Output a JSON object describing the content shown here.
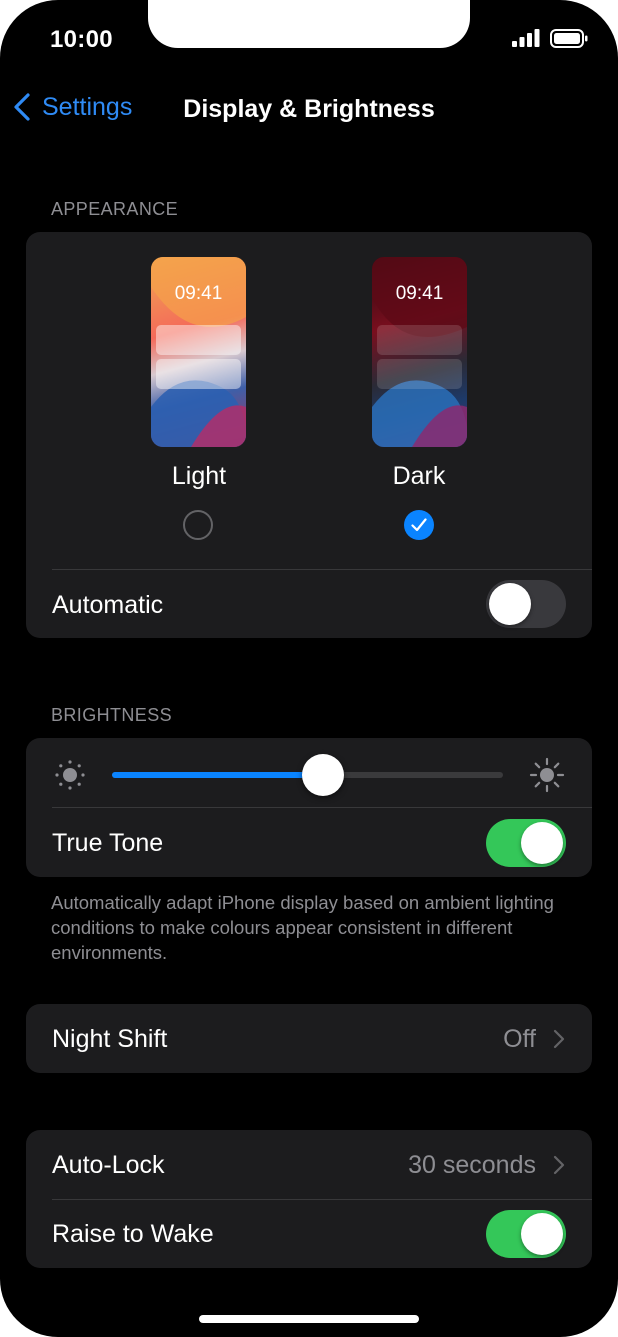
{
  "status_bar": {
    "time": "10:00"
  },
  "nav": {
    "back_label": "Settings",
    "title": "Display & Brightness"
  },
  "appearance": {
    "header": "APPEARANCE",
    "light": {
      "time": "09:41",
      "label": "Light",
      "selected": false
    },
    "dark": {
      "time": "09:41",
      "label": "Dark",
      "selected": true
    },
    "automatic": {
      "label": "Automatic",
      "on": false
    }
  },
  "brightness": {
    "header": "BRIGHTNESS",
    "level": 0.54,
    "true_tone": {
      "label": "True Tone",
      "on": true
    },
    "footnote": "Automatically adapt iPhone display based on ambient lighting conditions to make colours appear consistent in different environments."
  },
  "night_shift": {
    "label": "Night Shift",
    "value": "Off"
  },
  "auto_lock": {
    "label": "Auto-Lock",
    "value": "30 seconds"
  },
  "raise_to_wake": {
    "label": "Raise to Wake",
    "on": true
  },
  "colors": {
    "accent": "#0a84ff",
    "toggle_on": "#34c759",
    "background": "#000000",
    "card": "#1c1c1e"
  },
  "icons": {
    "back": "chevron-left-icon",
    "disclosure": "chevron-right-icon",
    "brightness_low": "sun-small-icon",
    "brightness_high": "sun-large-icon",
    "check": "checkmark-icon",
    "signal": "cellular-signal-icon",
    "battery": "battery-icon"
  }
}
